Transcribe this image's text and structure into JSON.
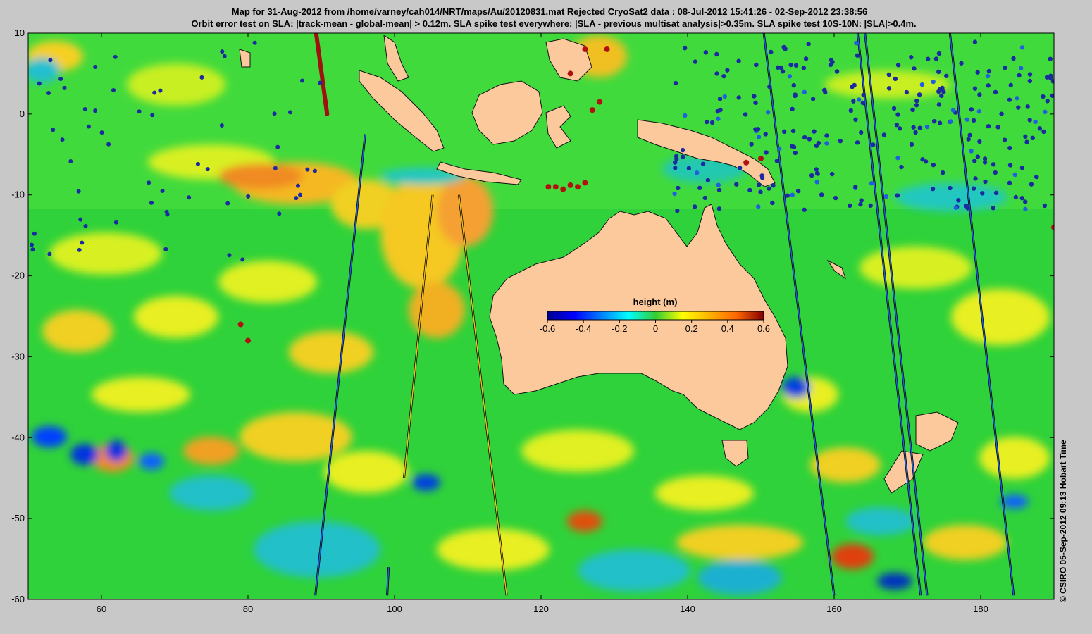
{
  "header": {
    "line1": "Map for 31-Aug-2012 from /home/varney/cah014/NRT/maps/Au/20120831.mat  Rejected CryoSat2 data : 08-Jul-2012 15:41:26 - 02-Sep-2012 23:38:56",
    "line2": "Orbit error test on SLA: |track-mean  - global-mean| > 0.12m.  SLA spike test everywhere: |SLA - previous multisat analysis|>0.35m. SLA spike test 10S-10N: |SLA|>0.4m."
  },
  "credit": "© CSIRO 05-Sep-2012 09:13 Hobart Time",
  "colors": {
    "land": "#fcc99c",
    "ocean_base": "#2fd23a",
    "frame_bg": "#c8c8c8"
  },
  "colorbar": {
    "title": "height (m)",
    "ticks": [
      "-0.6",
      "-0.4",
      "-0.2",
      "0",
      "0.2",
      "0.4",
      "0.6"
    ],
    "range": [
      -0.6,
      0.6
    ]
  },
  "chart_data": {
    "type": "map",
    "xlim": [
      50,
      190
    ],
    "ylim": [
      -60,
      10
    ],
    "x_ticks": [
      "60",
      "80",
      "100",
      "120",
      "140",
      "160",
      "180"
    ],
    "y_ticks": [
      "10",
      "0",
      "-10",
      "-20",
      "-30",
      "-40",
      "-50",
      "-60"
    ],
    "colormap": "jet",
    "tracks": [
      {
        "lon_start": 89.2,
        "lat_start": -59.5,
        "lon_end": 96.0,
        "lat_end": -2.5,
        "color": "#2060e0"
      },
      {
        "lon_start": 99.0,
        "lat_start": -59.5,
        "lon_end": 99.2,
        "lat_end": -56.0,
        "color": "#2060e0"
      },
      {
        "lon_start": 101.3,
        "lat_start": -45.0,
        "lon_end": 105.2,
        "lat_end": -10.0,
        "color": "#f0c020"
      },
      {
        "lon_start": 108.8,
        "lat_start": -10.0,
        "lon_end": 115.3,
        "lat_end": -59.5,
        "color": "#f0c020"
      },
      {
        "lon_start": 150.4,
        "lat_start": 10.0,
        "lon_end": 160.0,
        "lat_end": -59.5,
        "color": "#2060e0"
      },
      {
        "lon_start": 163.2,
        "lat_start": 10.0,
        "lon_end": 171.8,
        "lat_end": -59.5,
        "color": "#2060e0"
      },
      {
        "lon_start": 164.2,
        "lat_start": 10.0,
        "lon_end": 172.7,
        "lat_end": -59.5,
        "color": "#2060e0"
      },
      {
        "lon_start": 175.8,
        "lat_start": 10.0,
        "lon_end": 184.5,
        "lat_end": -59.5,
        "color": "#2060e0"
      }
    ],
    "red_track": {
      "lon_start": 89.3,
      "lat_start": 10.0,
      "lon_end": 90.8,
      "lat_end": 0.0
    }
  }
}
